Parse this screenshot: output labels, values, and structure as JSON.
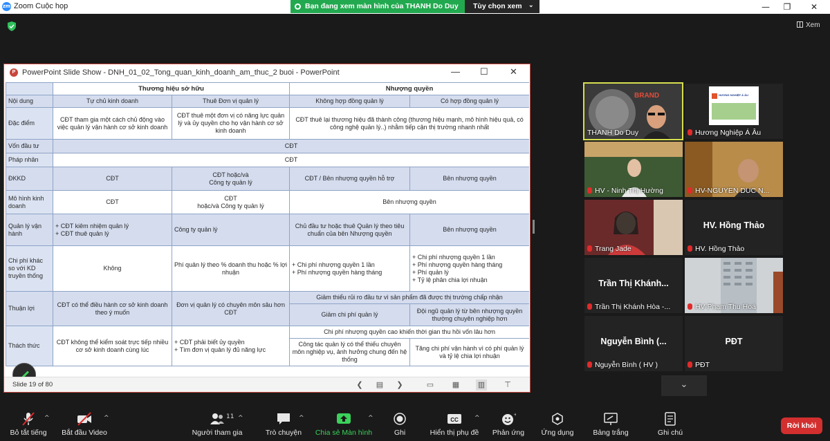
{
  "window": {
    "title": "Zoom Cuộc họp"
  },
  "banner": {
    "text": "Bạn đang xem màn hình của THANH Do Duy",
    "view_options": "Tùy chọn xem"
  },
  "view_button": "Xem",
  "ppt": {
    "title": "PowerPoint Slide Show  -  DNH_01_02_Tong_quan_kinh_doanh_am_thuc_2 buoi  -  PowerPoint",
    "status": "Slide 19 of 80"
  },
  "slide": {
    "header1": "Thương hiệu sở hữu",
    "header2": "Nhượng quyền",
    "r1": [
      "Nội dung",
      "Tự chủ kinh doanh",
      "Thuê Đơn vị quản lý",
      "Không hợp đồng quản lý",
      "Có hợp đồng quản lý"
    ],
    "r2": [
      "Đặc điểm",
      "CĐT tham gia một cách chủ động vào việc quản lý vận hành cơ sở kinh doanh",
      "CĐT thuê một đơn vị có năng lực quản lý và ủy quyền cho họ vận hành cơ sở kinh doanh",
      "CĐT thuê lại thương hiệu đã thành công (thương hiệu mạnh, mô hình hiệu quả, có công nghệ quản lý..) nhằm tiếp cận thị trường nhanh nhất"
    ],
    "r3": [
      "Vốn đầu tư",
      "CĐT"
    ],
    "r4": [
      "Pháp nhân",
      "CĐT"
    ],
    "r5": [
      "ĐKKD",
      "CĐT",
      "CĐT hoặc/và\nCông ty quản lý",
      "CĐT / Bên nhượng quyền hỗ trợ",
      "Bên nhượng quyền"
    ],
    "r6": [
      "Mô hình kinh doanh",
      "CĐT",
      "CĐT\nhoặc/và Công ty quản lý",
      "Bên nhượng quyền"
    ],
    "r7": [
      "Quản lý vận hành",
      "+ CĐT kiêm nhiệm quản lý\n+ CĐT thuê quản lý",
      "Công ty quản lý",
      "Chủ đầu tư hoặc thuê Quản lý theo tiêu chuẩn của bên Nhượng quyền",
      "Bên nhượng quyền"
    ],
    "r8": [
      "Chi phí khác so với KD truyền thống",
      "Không",
      "Phí quản lý theo % doanh thu hoặc % lợi nhuận",
      "+ Chi phí nhượng quyền 1 lần\n+ Phí nhượng quyền hàng tháng",
      "+ Chi phí nhượng quyền 1 lần\n+ Phí nhượng quyền hàng tháng\n+ Phí quản lý\n+ Tỷ lệ phân chia lợi nhuận"
    ],
    "r9": [
      "Thuận lợi",
      "CĐT có thể điều hành cơ sở kinh doanh theo ý muốn",
      "Đơn vị quản lý có chuyên môn sâu hơn CĐT",
      "Giảm thiểu rủi ro đầu tư vì sản phẩm đã được thị trường chấp nhận",
      "Giảm chi phí quản lý",
      "Đội ngũ quản lý từ bên nhượng quyền thường chuyên nghiệp hơn"
    ],
    "r10": [
      "Thách thức",
      "CĐT không thể kiểm soát trực tiếp nhiều cơ sở kinh doanh cùng lúc",
      "+ CĐT phải biết ủy quyền\n+ Tìm đơn vị quản lý đủ năng lực",
      "Chi phí nhượng quyền cao khiến thời gian thu hồi vốn lâu hơn",
      "Công tác quản lý có thể thiếu chuyên môn nghiệp vụ, ảnh hưởng chung đến hệ thống",
      "Tăng chi phí vận hành vì có phí quản lý và tỷ lệ chia lợi nhuận"
    ]
  },
  "participants": [
    {
      "name": "THANH Do Duy"
    },
    {
      "name": "Hương Nghiệp Á Âu"
    },
    {
      "name": "HV - Ninh Thị Hường"
    },
    {
      "name": "HV-NGUYEN DUC N..."
    },
    {
      "name": "Trang Jade"
    },
    {
      "name": "HV. Hồng Thảo",
      "big": "HV. Hồng Thảo"
    },
    {
      "name": "Trần Thị Khánh Hòa -...",
      "big": "Trần Thị Khánh..."
    },
    {
      "name": "HV-Phạm Thu Hoà"
    },
    {
      "name": "Nguyễn Bình ( HV )",
      "big": "Nguyễn Bình (..."
    },
    {
      "name": "PĐT",
      "big": "PĐT"
    }
  ],
  "logo_text": "HƯƠNG NGHIỆP Á ÂU",
  "toolbar": {
    "mute": "Bỏ tắt tiếng",
    "video": "Bắt đầu Video",
    "participants": "Người tham gia",
    "participants_count": "11",
    "chat": "Trò chuyện",
    "share": "Chia sẻ Màn hình",
    "record": "Ghi",
    "cc": "Hiển thị phụ đề",
    "reactions": "Phản ứng",
    "apps": "Ứng dụng",
    "whiteboard": "Bảng trắng",
    "notes": "Ghi chú",
    "leave": "Rời khỏi"
  }
}
